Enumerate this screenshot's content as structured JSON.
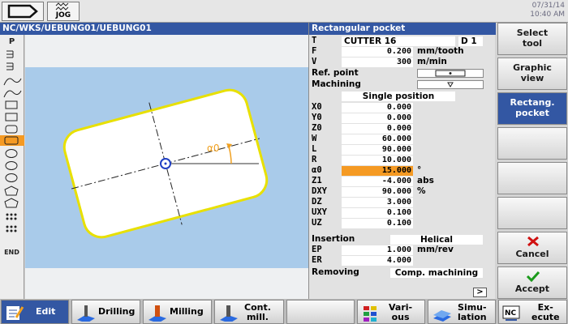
{
  "topbar": {
    "mode_label": "JOG",
    "date": "07/31/14",
    "time": "10:40 AM"
  },
  "path": "NC/WKS/UEBUNG01/UEBUNG01",
  "sidebar": {
    "items": [
      {
        "icon": "P"
      },
      {
        "icon": "drill-list-icon"
      },
      {
        "icon": "drill-list-icon"
      },
      {
        "icon": "contour-icon"
      },
      {
        "icon": "contour-icon"
      },
      {
        "icon": "slot-icon"
      },
      {
        "icon": "slot-icon"
      },
      {
        "icon": "rect-pocket-icon"
      },
      {
        "icon": "circ-pocket-icon"
      },
      {
        "icon": "circ-pocket-icon"
      },
      {
        "icon": "circ-pocket-icon"
      },
      {
        "icon": "polygon-icon"
      },
      {
        "icon": "polygon-icon"
      },
      {
        "icon": "hole-pattern-icon"
      },
      {
        "icon": "hole-pattern-icon"
      },
      {
        "icon": "END"
      }
    ]
  },
  "graphic": {
    "angle_label": "α0",
    "colors": {
      "outline": "#e8e000",
      "accent": "#f0a020",
      "center": "#1f3fc4"
    }
  },
  "panel": {
    "title": "Rectangular pocket",
    "tool_label": "T",
    "tool_name": "CUTTER 16",
    "tool_d": "D 1",
    "rows": [
      {
        "name": "F",
        "value": "0.200",
        "unit": "mm/tooth"
      },
      {
        "name": "V",
        "value": "300",
        "unit": "m/min"
      }
    ],
    "ref_point_label": "Ref. point",
    "machining_label": "Machining",
    "position_mode": "Single position",
    "params": [
      {
        "name": "X0",
        "value": "0.000",
        "unit": ""
      },
      {
        "name": "Y0",
        "value": "0.000",
        "unit": ""
      },
      {
        "name": "Z0",
        "value": "0.000",
        "unit": ""
      },
      {
        "name": "W",
        "value": "60.000",
        "unit": ""
      },
      {
        "name": "L",
        "value": "90.000",
        "unit": ""
      },
      {
        "name": "R",
        "value": "10.000",
        "unit": ""
      },
      {
        "name": "α0",
        "value": "15.000",
        "unit": "°"
      },
      {
        "name": "Z1",
        "value": "-4.000",
        "unit": "abs"
      },
      {
        "name": "DXY",
        "value": "90.000",
        "unit": "%"
      },
      {
        "name": "DZ",
        "value": "3.000",
        "unit": ""
      },
      {
        "name": "UXY",
        "value": "0.100",
        "unit": ""
      },
      {
        "name": "UZ",
        "value": "0.100",
        "unit": ""
      }
    ],
    "insertion_label": "Insertion",
    "insertion_value": "Helical",
    "ep": {
      "name": "EP",
      "value": "1.000",
      "unit": "mm/rev"
    },
    "er": {
      "name": "ER",
      "value": "4.000",
      "unit": ""
    },
    "removing_label": "Removing",
    "removing_value": "Comp. machining",
    "more_label": ">"
  },
  "vsoftkeys": [
    {
      "label": "Select\ntool"
    },
    {
      "label": "Graphic\nview"
    },
    {
      "label": "Rectang.\npocket"
    },
    {
      "label": ""
    },
    {
      "label": ""
    },
    {
      "label": ""
    },
    {
      "label": "Cancel"
    },
    {
      "label": "Accept"
    }
  ],
  "hsoftkeys": [
    {
      "label": "Edit"
    },
    {
      "label": "Drilling"
    },
    {
      "label": "Milling"
    },
    {
      "label": "Cont.\nmill."
    },
    {
      "label": ""
    },
    {
      "label": "Vari-\nous"
    },
    {
      "label": "Simu-\nlation"
    },
    {
      "label": "Ex-\necute"
    }
  ],
  "colors": {
    "accent": "#3357a3",
    "highlight": "#f59a23"
  }
}
